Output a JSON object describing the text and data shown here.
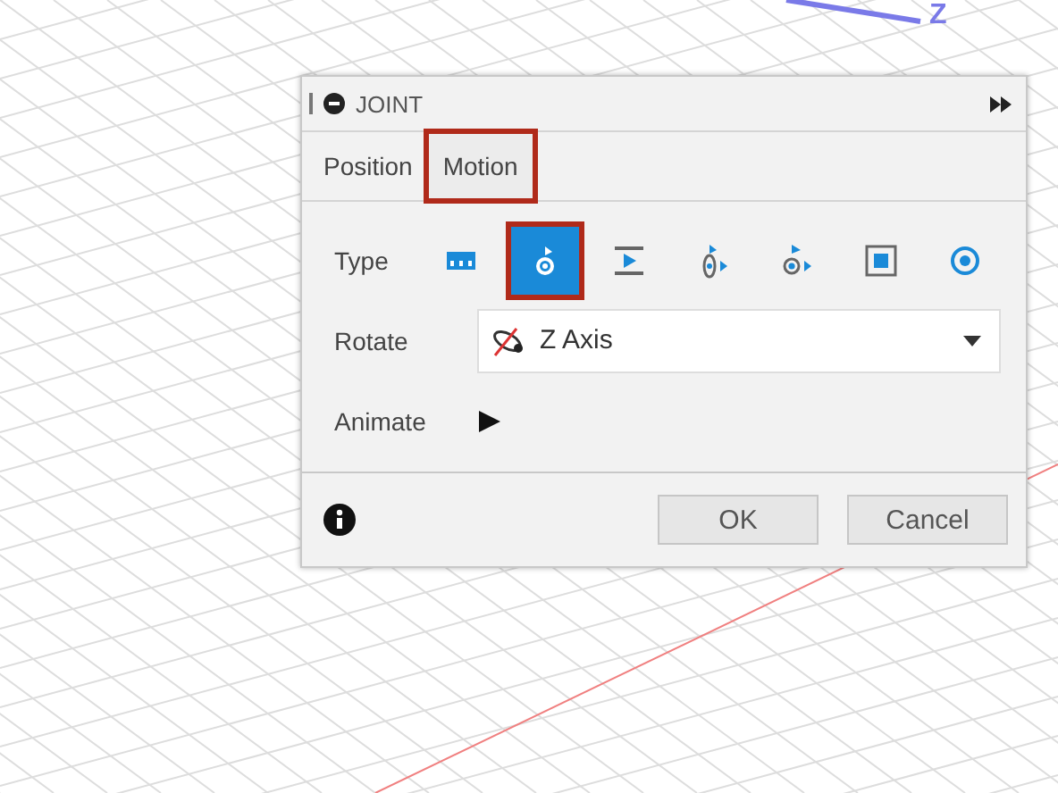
{
  "viewport": {
    "axis_label": "Z"
  },
  "dialog": {
    "title": "JOINT",
    "tabs": [
      {
        "label": "Position",
        "selected": false,
        "highlighted": false
      },
      {
        "label": "Motion",
        "selected": true,
        "highlighted": true
      }
    ],
    "type": {
      "label": "Type",
      "options": [
        {
          "kind": "rigid",
          "selected": false,
          "highlighted": false
        },
        {
          "kind": "revolute",
          "selected": true,
          "highlighted": true
        },
        {
          "kind": "slider",
          "selected": false,
          "highlighted": false
        },
        {
          "kind": "cylindrical",
          "selected": false,
          "highlighted": false
        },
        {
          "kind": "pin-slot",
          "selected": false,
          "highlighted": false
        },
        {
          "kind": "planar",
          "selected": false,
          "highlighted": false
        },
        {
          "kind": "ball",
          "selected": false,
          "highlighted": false
        }
      ]
    },
    "rotate": {
      "label": "Rotate",
      "value": "Z Axis"
    },
    "animate": {
      "label": "Animate"
    },
    "buttons": [
      {
        "label": "OK"
      },
      {
        "label": "Cancel"
      }
    ]
  }
}
